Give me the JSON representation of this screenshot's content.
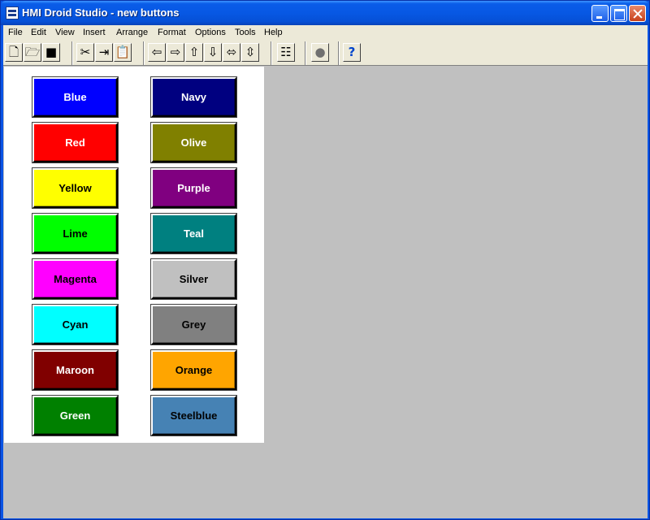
{
  "window": {
    "title": "HMI Droid Studio - new buttons"
  },
  "menu": [
    "File",
    "Edit",
    "View",
    "Insert",
    "Arrange",
    "Format",
    "Options",
    "Tools",
    "Help"
  ],
  "toolbar": {
    "tools": [
      {
        "name": "new-file-icon",
        "glyph": "🗋"
      },
      {
        "name": "open-folder-icon",
        "glyph": "🗁"
      },
      {
        "name": "save-disk-icon",
        "glyph": "■"
      },
      {
        "name": "cut-scissors-icon",
        "glyph": "✂"
      },
      {
        "name": "copy-icon",
        "glyph": "⇥"
      },
      {
        "name": "paste-icon",
        "glyph": "📋"
      },
      {
        "name": "align-left-arrow-icon",
        "glyph": "⇦"
      },
      {
        "name": "align-right-arrow-icon",
        "glyph": "⇨"
      },
      {
        "name": "align-top-arrow-icon",
        "glyph": "⇧"
      },
      {
        "name": "align-bottom-arrow-icon",
        "glyph": "⇩"
      },
      {
        "name": "horizontal-resize-icon",
        "glyph": "⬄"
      },
      {
        "name": "vertical-resize-icon",
        "glyph": "⇳"
      },
      {
        "name": "properties-icon",
        "glyph": "☷"
      },
      {
        "name": "record-circle-icon",
        "glyph": "●"
      },
      {
        "name": "help-icon",
        "glyph": "?"
      }
    ]
  },
  "buttons": {
    "left": [
      {
        "label": "Blue",
        "bg": "#0000ff",
        "fg": "#ffffff"
      },
      {
        "label": "Red",
        "bg": "#ff0000",
        "fg": "#ffffff"
      },
      {
        "label": "Yellow",
        "bg": "#ffff00",
        "fg": "#000000"
      },
      {
        "label": "Lime",
        "bg": "#00ff00",
        "fg": "#000000"
      },
      {
        "label": "Magenta",
        "bg": "#ff00ff",
        "fg": "#000000"
      },
      {
        "label": "Cyan",
        "bg": "#00ffff",
        "fg": "#000000"
      },
      {
        "label": "Maroon",
        "bg": "#800000",
        "fg": "#ffffff"
      },
      {
        "label": "Green",
        "bg": "#008000",
        "fg": "#ffffff"
      }
    ],
    "right": [
      {
        "label": "Navy",
        "bg": "#000080",
        "fg": "#ffffff"
      },
      {
        "label": "Olive",
        "bg": "#808000",
        "fg": "#ffffff"
      },
      {
        "label": "Purple",
        "bg": "#800080",
        "fg": "#ffffff"
      },
      {
        "label": "Teal",
        "bg": "#008080",
        "fg": "#ffffff"
      },
      {
        "label": "Silver",
        "bg": "#c0c0c0",
        "fg": "#000000"
      },
      {
        "label": "Grey",
        "bg": "#808080",
        "fg": "#000000"
      },
      {
        "label": "Orange",
        "bg": "#ffa500",
        "fg": "#000000"
      },
      {
        "label": "Steelblue",
        "bg": "#4682b4",
        "fg": "#000000"
      }
    ]
  }
}
